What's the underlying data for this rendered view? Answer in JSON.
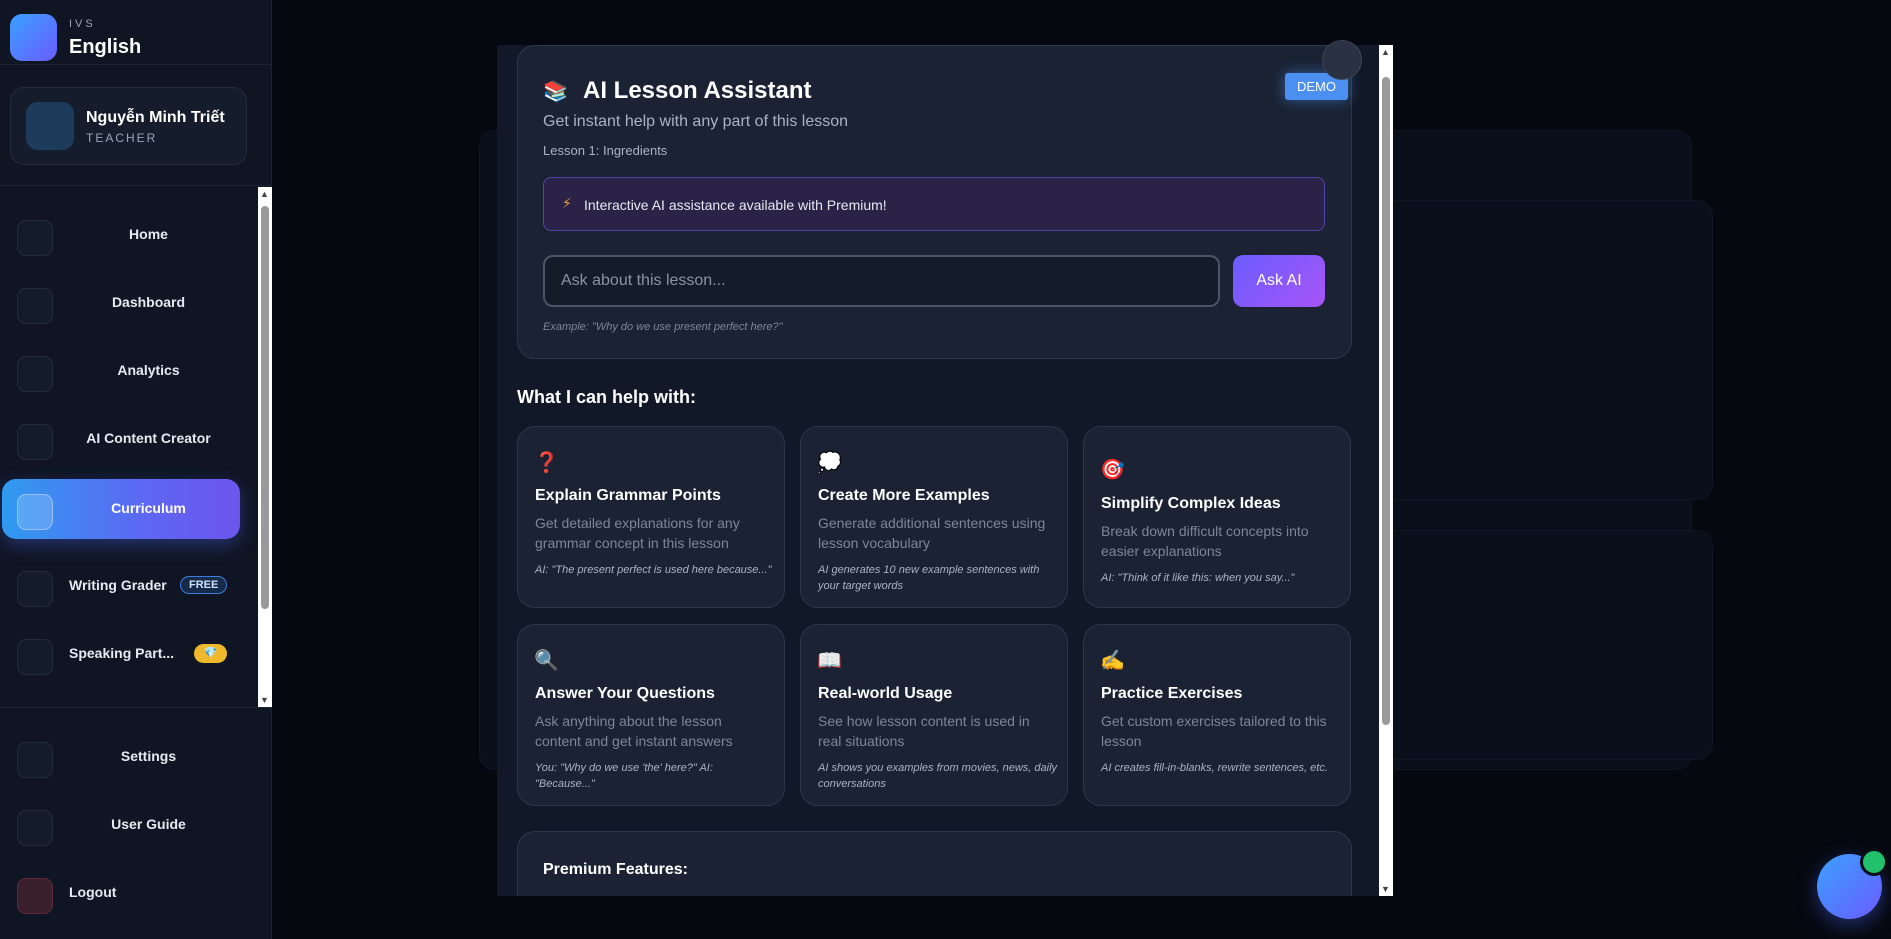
{
  "brand": {
    "sub": "IVS",
    "title": "English"
  },
  "user": {
    "name": "Nguyễn Minh Triết",
    "role": "TEACHER"
  },
  "nav": {
    "items": [
      {
        "label": "Home",
        "icon": "home-icon"
      },
      {
        "label": "Dashboard",
        "icon": "dashboard-icon"
      },
      {
        "label": "Analytics",
        "icon": "analytics-icon"
      },
      {
        "label": "AI Content Creator",
        "icon": "ai-content-icon"
      },
      {
        "label": "Curriculum",
        "icon": "curriculum-icon",
        "active": true
      },
      {
        "label": "Writing Grader",
        "icon": "writing-icon",
        "badge": "FREE"
      },
      {
        "label": "Speaking Part...",
        "icon": "speaking-icon",
        "badge": "💎"
      }
    ],
    "bottom": [
      {
        "label": "Settings",
        "icon": "settings-icon"
      },
      {
        "label": "User Guide",
        "icon": "guide-icon"
      },
      {
        "label": "Logout",
        "icon": "logout-icon"
      }
    ]
  },
  "assistant": {
    "icon": "📚",
    "title": "AI Lesson Assistant",
    "badge": "DEMO",
    "subtitle": "Get instant help with any part of this lesson",
    "lesson": "Lesson 1: Ingredients",
    "promo_icon": "⚡",
    "promo": "Interactive AI assistance available with Premium!",
    "input_placeholder": "Ask about this lesson...",
    "ask_button": "Ask AI",
    "example": "Example: \"Why do we use present perfect here?\""
  },
  "help": {
    "heading": "What I can help with:",
    "cards": [
      {
        "icon": "❓",
        "title": "Explain Grammar Points",
        "desc": "Get detailed explanations for any grammar concept in this lesson",
        "example": "AI: \"The present perfect is used here because...\""
      },
      {
        "icon": "💭",
        "title": "Create More Examples",
        "desc": "Generate additional sentences using lesson vocabulary",
        "example": "AI generates 10 new example sentences with your target words"
      },
      {
        "icon": "🎯",
        "title": "Simplify Complex Ideas",
        "desc": "Break down difficult concepts into easier explanations",
        "example": "AI: \"Think of it like this: when you say...\""
      },
      {
        "icon": "🔍",
        "title": "Answer Your Questions",
        "desc": "Ask anything about the lesson content and get instant answers",
        "example": "You: \"Why do we use 'the' here?\" AI: \"Because...\""
      },
      {
        "icon": "📖",
        "title": "Real-world Usage",
        "desc": "See how lesson content is used in real situations",
        "example": "AI shows you examples from movies, news, daily conversations"
      },
      {
        "icon": "✍️",
        "title": "Practice Exercises",
        "desc": "Get custom exercises tailored to this lesson",
        "example": "AI creates fill-in-blanks, rewrite sentences, etc."
      }
    ]
  },
  "premium": {
    "title": "Premium Features:"
  },
  "colors": {
    "accent": "#6a5cff",
    "active_nav": "#2f9bf0",
    "demo": "#4b8ff0",
    "online": "#21c06a"
  }
}
